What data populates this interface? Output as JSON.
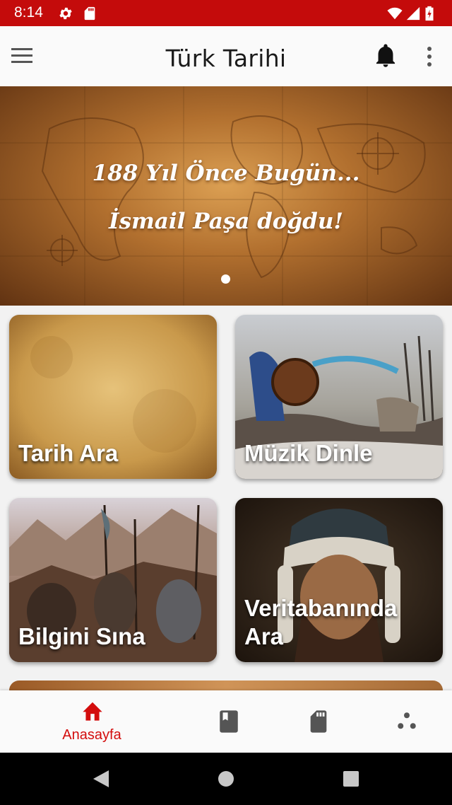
{
  "status_bar": {
    "time": "8:14",
    "icons": [
      "settings-icon",
      "sd-card-icon",
      "wifi-icon",
      "signal-icon",
      "battery-icon"
    ],
    "color": "#c40b0b"
  },
  "app_bar": {
    "title": "Türk Tarihi",
    "icons": [
      "menu-icon",
      "notifications-icon",
      "more-vert-icon"
    ]
  },
  "banner": {
    "line1": "188 Yıl Önce Bugün...",
    "line2": "İsmail Paşa doğdu!",
    "page_indicator": {
      "pages": 1,
      "current": 1
    }
  },
  "cards": [
    {
      "label": "Tarih Ara"
    },
    {
      "label": "Müzik Dinle"
    },
    {
      "label": "Bilgini Sına"
    },
    {
      "label": "Veritabanında Ara"
    }
  ],
  "bottom_nav": {
    "accent": "#d30d0d",
    "items": [
      {
        "icon": "home-icon",
        "label": "Anasayfa",
        "active": true
      },
      {
        "icon": "book-icon",
        "active": false
      },
      {
        "icon": "sd-card-icon",
        "active": false
      },
      {
        "icon": "scatter-dots-icon",
        "active": false
      }
    ]
  },
  "system_nav": {
    "icons": [
      "back-icon",
      "home-circle-icon",
      "recents-icon"
    ]
  }
}
